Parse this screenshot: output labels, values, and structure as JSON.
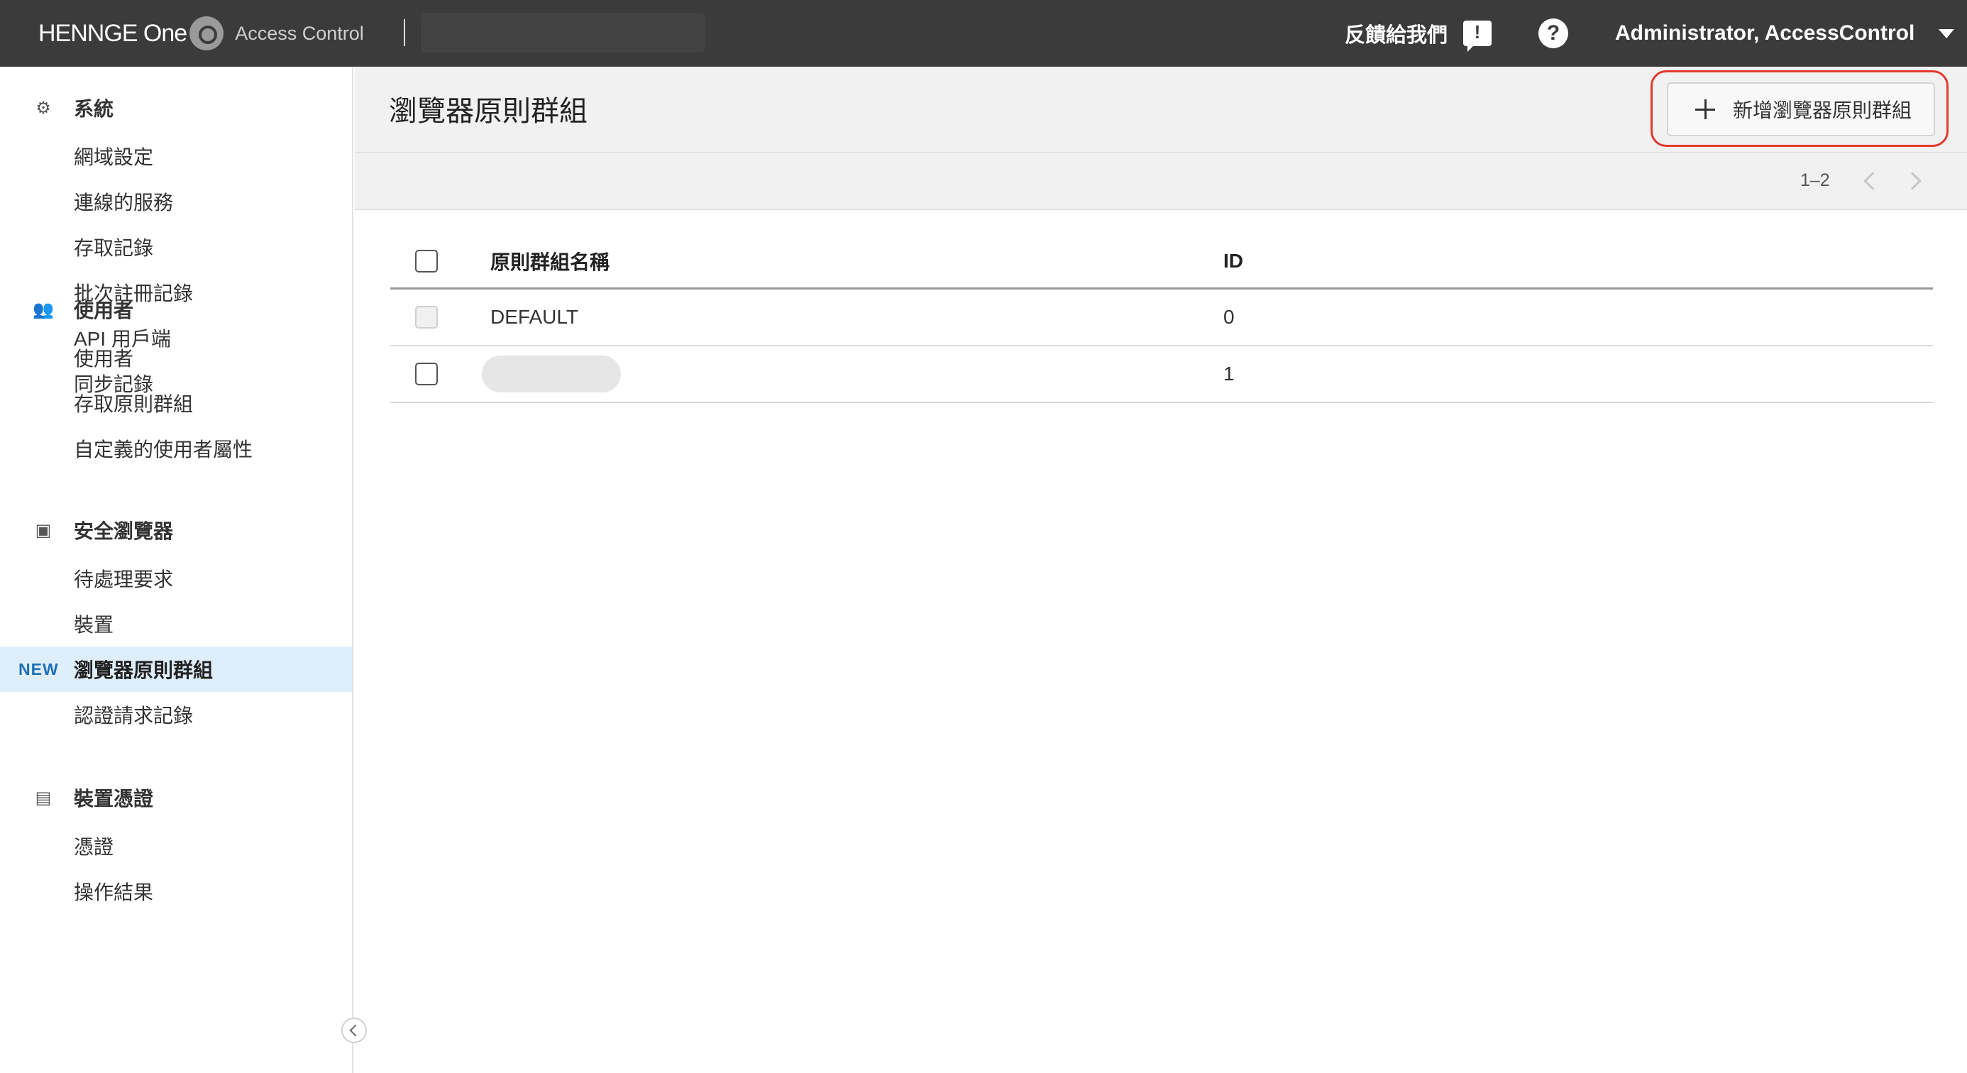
{
  "topbar": {
    "logo_text": "HENNGE One",
    "logo_subtitle": "Access Control",
    "feedback_label": "反饋給我們",
    "help_symbol": "?",
    "user_label": "Administrator, AccessControl",
    "icons": [
      "logo-mark-icon",
      "feedback-icon",
      "help-icon",
      "caret-down-icon"
    ]
  },
  "sidebar": {
    "sections": [
      {
        "label": "系統",
        "icon": "gear-icon",
        "items": [
          "網域設定",
          "連線的服務",
          "存取記錄",
          "批次註冊記錄",
          "API 用戶端",
          "同步記錄"
        ]
      },
      {
        "label": "使用者",
        "icon": "users-icon",
        "items": [
          "使用者",
          "存取原則群組",
          "自定義的使用者屬性"
        ]
      },
      {
        "label": "安全瀏覽器",
        "icon": "browser-icon",
        "items": [
          "待處理要求",
          "裝置",
          "瀏覽器原則群組",
          "認證請求記錄"
        ]
      },
      {
        "label": "裝置憑證",
        "icon": "certificate-icon",
        "items": [
          "憑證",
          "操作結果"
        ]
      }
    ],
    "active_item": "瀏覽器原則群組",
    "new_badge": "NEW"
  },
  "main": {
    "title": "瀏覽器原則群組",
    "add_button_label": "新增瀏覽器原則群組",
    "pager": {
      "range": "1–2"
    },
    "table": {
      "columns": [
        "原則群組名稱",
        "ID"
      ],
      "rows": [
        {
          "name": "DEFAULT",
          "id": "0",
          "checkbox_disabled": true
        },
        {
          "name": "",
          "id": "1",
          "checkbox_disabled": false,
          "name_redacted": true
        }
      ]
    }
  },
  "colors": {
    "topbar_bg": "#3b3b3b",
    "active_nav_bg": "#dfeefb",
    "new_badge": "#1f6fb8",
    "highlight_ring": "#e23a2f"
  }
}
